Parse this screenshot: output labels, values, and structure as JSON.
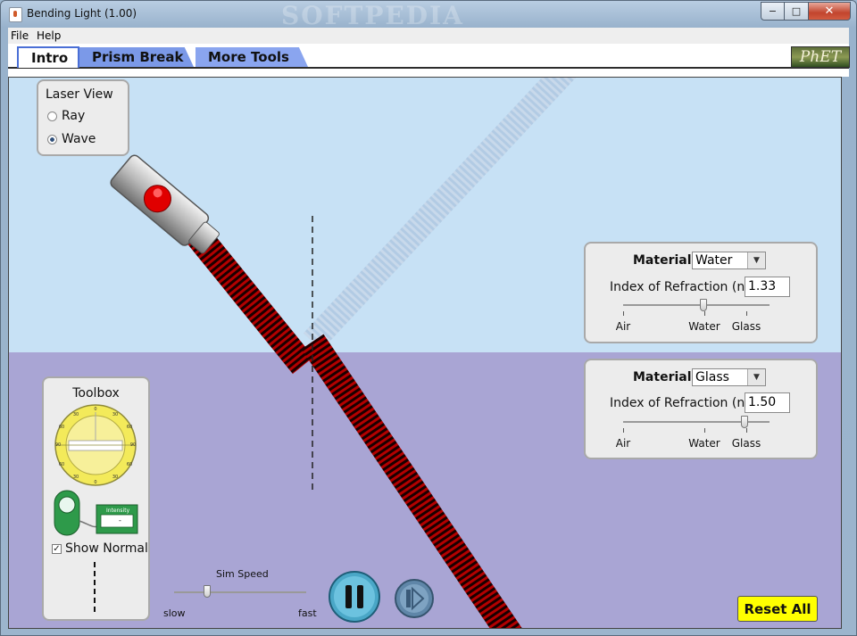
{
  "window": {
    "title": "Bending Light (1.00)",
    "watermark": "SOFTPEDIA",
    "minimize_glyph": "−",
    "maximize_glyph": "□",
    "close_glyph": "✕"
  },
  "menu": {
    "items": [
      "File",
      "Help"
    ]
  },
  "tabs": [
    {
      "label": "Intro",
      "selected": true
    },
    {
      "label": "Prism Break",
      "selected": false
    },
    {
      "label": "More Tools",
      "selected": false
    }
  ],
  "logo": "PhET",
  "laser_view": {
    "title": "Laser View",
    "options": [
      {
        "label": "Ray",
        "selected": false
      },
      {
        "label": "Wave",
        "selected": true
      }
    ]
  },
  "top_medium": {
    "material_label": "Material:",
    "material_value": "Water",
    "ior_label": "Index of Refraction (n):",
    "ior_value": "1.33",
    "slider_fraction": 0.55,
    "ticks": [
      "Air",
      "Water",
      "Glass"
    ]
  },
  "bottom_medium": {
    "material_label": "Material:",
    "material_value": "Glass",
    "ior_label": "Index of Refraction (n):",
    "ior_value": "1.50",
    "slider_fraction": 0.83,
    "ticks": [
      "Air",
      "Water",
      "Glass"
    ]
  },
  "toolbox": {
    "title": "Toolbox",
    "protractor_marks": [
      "0",
      "30",
      "60",
      "90",
      "30",
      "60",
      "90",
      "60",
      "30",
      "0",
      "30",
      "60",
      "90"
    ],
    "meter_label": "Intensity",
    "meter_value": "-",
    "show_normal_label": "Show Normal",
    "show_normal_checked": true
  },
  "sim_speed": {
    "label": "Sim Speed",
    "min_label": "slow",
    "max_label": "fast",
    "value_fraction": 0.25
  },
  "reset_label": "Reset All",
  "colors": {
    "upper_medium": "#c7e1f5",
    "lower_medium": "#a9a5d4",
    "beam": "#cc0000",
    "reset_button": "#ffff00"
  },
  "icons": [
    "laser-pointer-icon",
    "protractor-icon",
    "intensity-meter-icon",
    "pause-icon",
    "step-icon"
  ]
}
